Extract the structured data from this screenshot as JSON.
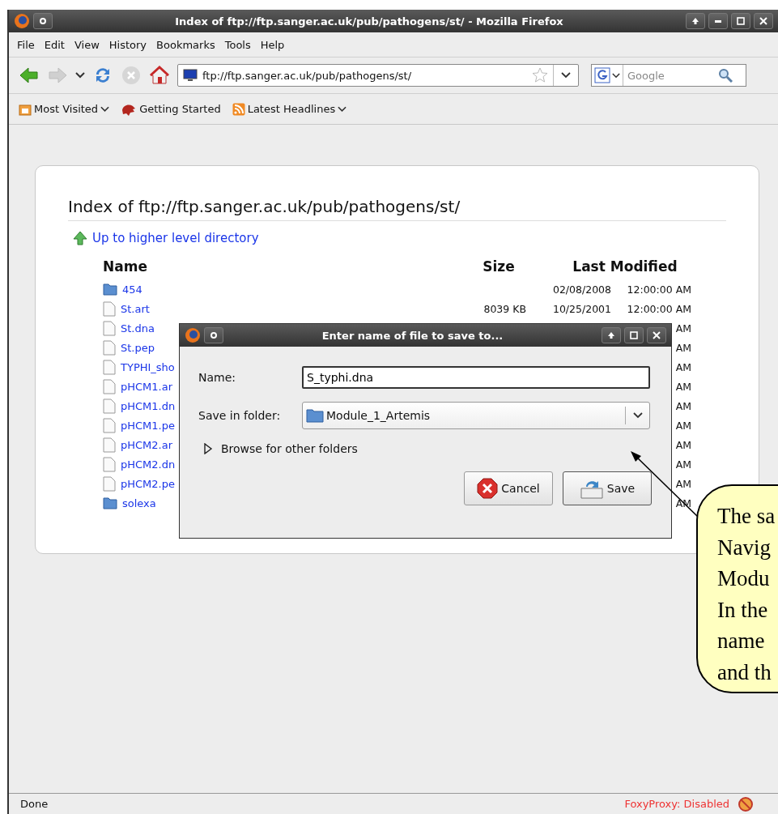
{
  "window": {
    "title": "Index of ftp://ftp.sanger.ac.uk/pub/pathogens/st/ - Mozilla Firefox"
  },
  "menu": [
    "File",
    "Edit",
    "View",
    "History",
    "Bookmarks",
    "Tools",
    "Help"
  ],
  "toolbar": {
    "url": "ftp://ftp.sanger.ac.uk/pub/pathogens/st/",
    "search_placeholder": "Google"
  },
  "bookmarks": [
    {
      "label": "Most Visited",
      "kind": "folder"
    },
    {
      "label": "Getting Started",
      "kind": "link"
    },
    {
      "label": "Latest Headlines",
      "kind": "feed"
    }
  ],
  "page": {
    "heading": "Index of ftp://ftp.sanger.ac.uk/pub/pathogens/st/",
    "up_link": "Up to higher level directory",
    "columns": [
      "Name",
      "Size",
      "Last Modified"
    ],
    "rows": [
      {
        "name": "454",
        "kind": "folder",
        "date": "02/08/2008",
        "time": "12:00:00 AM"
      },
      {
        "name": "St.art",
        "kind": "file",
        "size": "8039 KB",
        "date": "10/25/2001",
        "time": "12:00:00 AM"
      },
      {
        "name": "St.dna",
        "kind": "file",
        "time": "AM"
      },
      {
        "name": "St.pep",
        "kind": "file",
        "time": "AM"
      },
      {
        "name": "TYPHI_sho",
        "kind": "file",
        "time": "AM"
      },
      {
        "name": "pHCM1.ar",
        "kind": "file",
        "time": "AM"
      },
      {
        "name": "pHCM1.dn",
        "kind": "file",
        "time": "AM"
      },
      {
        "name": "pHCM1.pe",
        "kind": "file",
        "time": "AM"
      },
      {
        "name": "pHCM2.ar",
        "kind": "file",
        "time": "AM"
      },
      {
        "name": "pHCM2.dn",
        "kind": "file",
        "time": "AM"
      },
      {
        "name": "pHCM2.pe",
        "kind": "file",
        "time": "AM"
      },
      {
        "name": "solexa",
        "kind": "folder",
        "time": "AM"
      }
    ]
  },
  "dialog": {
    "title": "Enter name of file to save to...",
    "name_label": "Name:",
    "name_value": "S_typhi.dna",
    "folder_label": "Save in folder:",
    "folder": "Module_1_Artemis",
    "expander": "Browse for other folders",
    "expanded": false,
    "buttons": [
      {
        "label": "Cancel",
        "kind": "cancel"
      },
      {
        "label": "Save",
        "kind": "save"
      }
    ]
  },
  "callout": {
    "lines": [
      "The sa",
      "Navig",
      "Modu",
      "In the",
      "name",
      "and th"
    ]
  },
  "status_bar": {
    "text": "Done",
    "proxy": "FoxyProxy: Disabled"
  }
}
